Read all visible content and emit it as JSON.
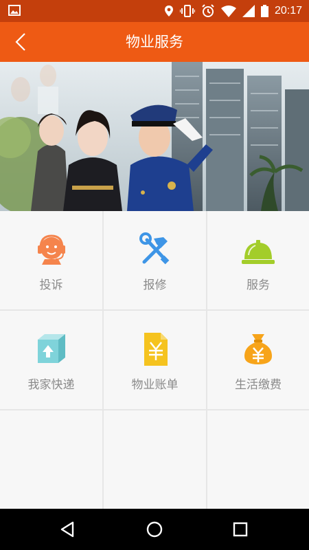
{
  "status_bar": {
    "time": "20:17",
    "icons": [
      "image-icon",
      "location-icon",
      "vibrate-icon",
      "alarm-icon",
      "wifi-icon",
      "signal-icon",
      "battery-icon"
    ]
  },
  "app_bar": {
    "title": "物业服务",
    "back_icon": "back-chevron-icon"
  },
  "banner": {
    "description_icons": [
      "property-staff-photo"
    ]
  },
  "services": [
    {
      "label": "投诉",
      "icon": "customer-service-headset-icon",
      "color": "#f5844c"
    },
    {
      "label": "报修",
      "icon": "hammer-wrench-icon",
      "color": "#3e95e6"
    },
    {
      "label": "服务",
      "icon": "service-bell-icon",
      "color": "#a3cd2a"
    },
    {
      "label": "我家快递",
      "icon": "package-box-icon",
      "color": "#7fd3da"
    },
    {
      "label": "物业账单",
      "icon": "bill-document-icon",
      "color": "#f5c31f"
    },
    {
      "label": "生活缴费",
      "icon": "money-bag-icon",
      "color": "#f7a41a"
    }
  ],
  "nav_bar": {
    "icons": [
      "back-triangle-icon",
      "home-circle-icon",
      "recents-square-icon"
    ]
  },
  "colors": {
    "appbar": "#ee5a14",
    "statusbar": "#c43f0c"
  }
}
